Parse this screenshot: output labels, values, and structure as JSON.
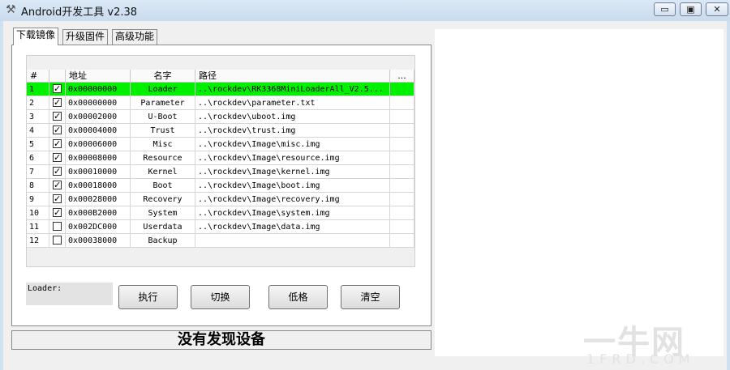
{
  "window": {
    "title": "Android开发工具 v2.38",
    "icon": "tools-icon",
    "buttons": {
      "minimize": "▭",
      "maximize": "▣",
      "close": "✕"
    }
  },
  "tabs": [
    {
      "label": "下载镜像",
      "active": true
    },
    {
      "label": "升级固件",
      "active": false
    },
    {
      "label": "高级功能",
      "active": false
    }
  ],
  "table": {
    "columns": [
      "#",
      "",
      "地址",
      "名字",
      "路径",
      "..."
    ],
    "rows": [
      {
        "idx": "1",
        "checked": true,
        "addr": "0x00000000",
        "name": "Loader",
        "path": "..\\rockdev\\RK3368MiniLoaderAll_V2.5...",
        "selected": true
      },
      {
        "idx": "2",
        "checked": true,
        "addr": "0x00000000",
        "name": "Parameter",
        "path": "..\\rockdev\\parameter.txt",
        "selected": false
      },
      {
        "idx": "3",
        "checked": true,
        "addr": "0x00002000",
        "name": "U-Boot",
        "path": "..\\rockdev\\uboot.img",
        "selected": false
      },
      {
        "idx": "4",
        "checked": true,
        "addr": "0x00004000",
        "name": "Trust",
        "path": "..\\rockdev\\trust.img",
        "selected": false
      },
      {
        "idx": "5",
        "checked": true,
        "addr": "0x00006000",
        "name": "Misc",
        "path": "..\\rockdev\\Image\\misc.img",
        "selected": false
      },
      {
        "idx": "6",
        "checked": true,
        "addr": "0x00008000",
        "name": "Resource",
        "path": "..\\rockdev\\Image\\resource.img",
        "selected": false
      },
      {
        "idx": "7",
        "checked": true,
        "addr": "0x00010000",
        "name": "Kernel",
        "path": "..\\rockdev\\Image\\kernel.img",
        "selected": false
      },
      {
        "idx": "8",
        "checked": true,
        "addr": "0x00018000",
        "name": "Boot",
        "path": "..\\rockdev\\Image\\boot.img",
        "selected": false
      },
      {
        "idx": "9",
        "checked": true,
        "addr": "0x00028000",
        "name": "Recovery",
        "path": "..\\rockdev\\Image\\recovery.img",
        "selected": false
      },
      {
        "idx": "10",
        "checked": true,
        "addr": "0x000B2000",
        "name": "System",
        "path": "..\\rockdev\\Image\\system.img",
        "selected": false
      },
      {
        "idx": "11",
        "checked": false,
        "addr": "0x002DC000",
        "name": "Userdata",
        "path": "..\\rockdev\\Image\\data.img",
        "selected": false
      },
      {
        "idx": "12",
        "checked": false,
        "addr": "0x00038000",
        "name": "Backup",
        "path": "",
        "selected": false
      }
    ]
  },
  "loader_label": "Loader:",
  "buttons": {
    "run": "执行",
    "switch": "切换",
    "lowformat": "低格",
    "clear": "清空"
  },
  "status": "没有发现设备",
  "watermark": {
    "big": "一牛网",
    "small": "1FRD.COM"
  },
  "colors": {
    "selected_row": "#00f000"
  }
}
